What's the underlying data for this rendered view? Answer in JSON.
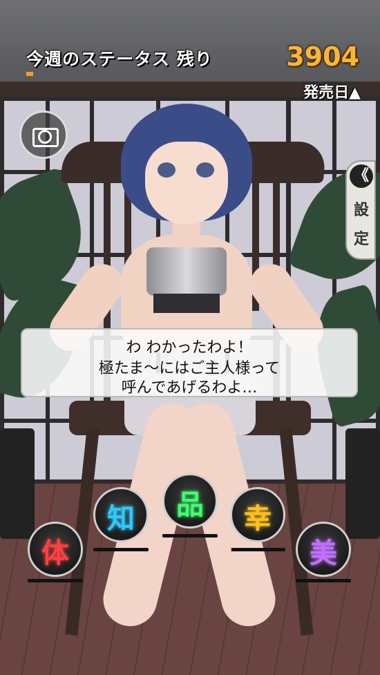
{
  "header": {
    "title": "今週のステータス 残り",
    "remaining_value": "3904",
    "release_label": "発売日▲"
  },
  "camera_button": {
    "icon": "camera-icon"
  },
  "settings": {
    "chevron": "《",
    "label_1": "設",
    "label_2": "定"
  },
  "dialog": {
    "line1": "わ わかったわよ！",
    "line2": "極たま～にはご主人様って",
    "line3": "呼んであげるわよ…"
  },
  "stats": [
    {
      "id": "body",
      "glyph": "体",
      "color": "#ff4040",
      "progress": 0
    },
    {
      "id": "intellect",
      "glyph": "知",
      "color": "#30c8ff",
      "progress": 0
    },
    {
      "id": "grace",
      "glyph": "品",
      "color": "#40ff70",
      "progress": 0
    },
    {
      "id": "luck",
      "glyph": "幸",
      "color": "#ffc020",
      "progress": 0.02
    },
    {
      "id": "beauty",
      "glyph": "美",
      "color": "#c070ff",
      "progress": 0
    }
  ]
}
